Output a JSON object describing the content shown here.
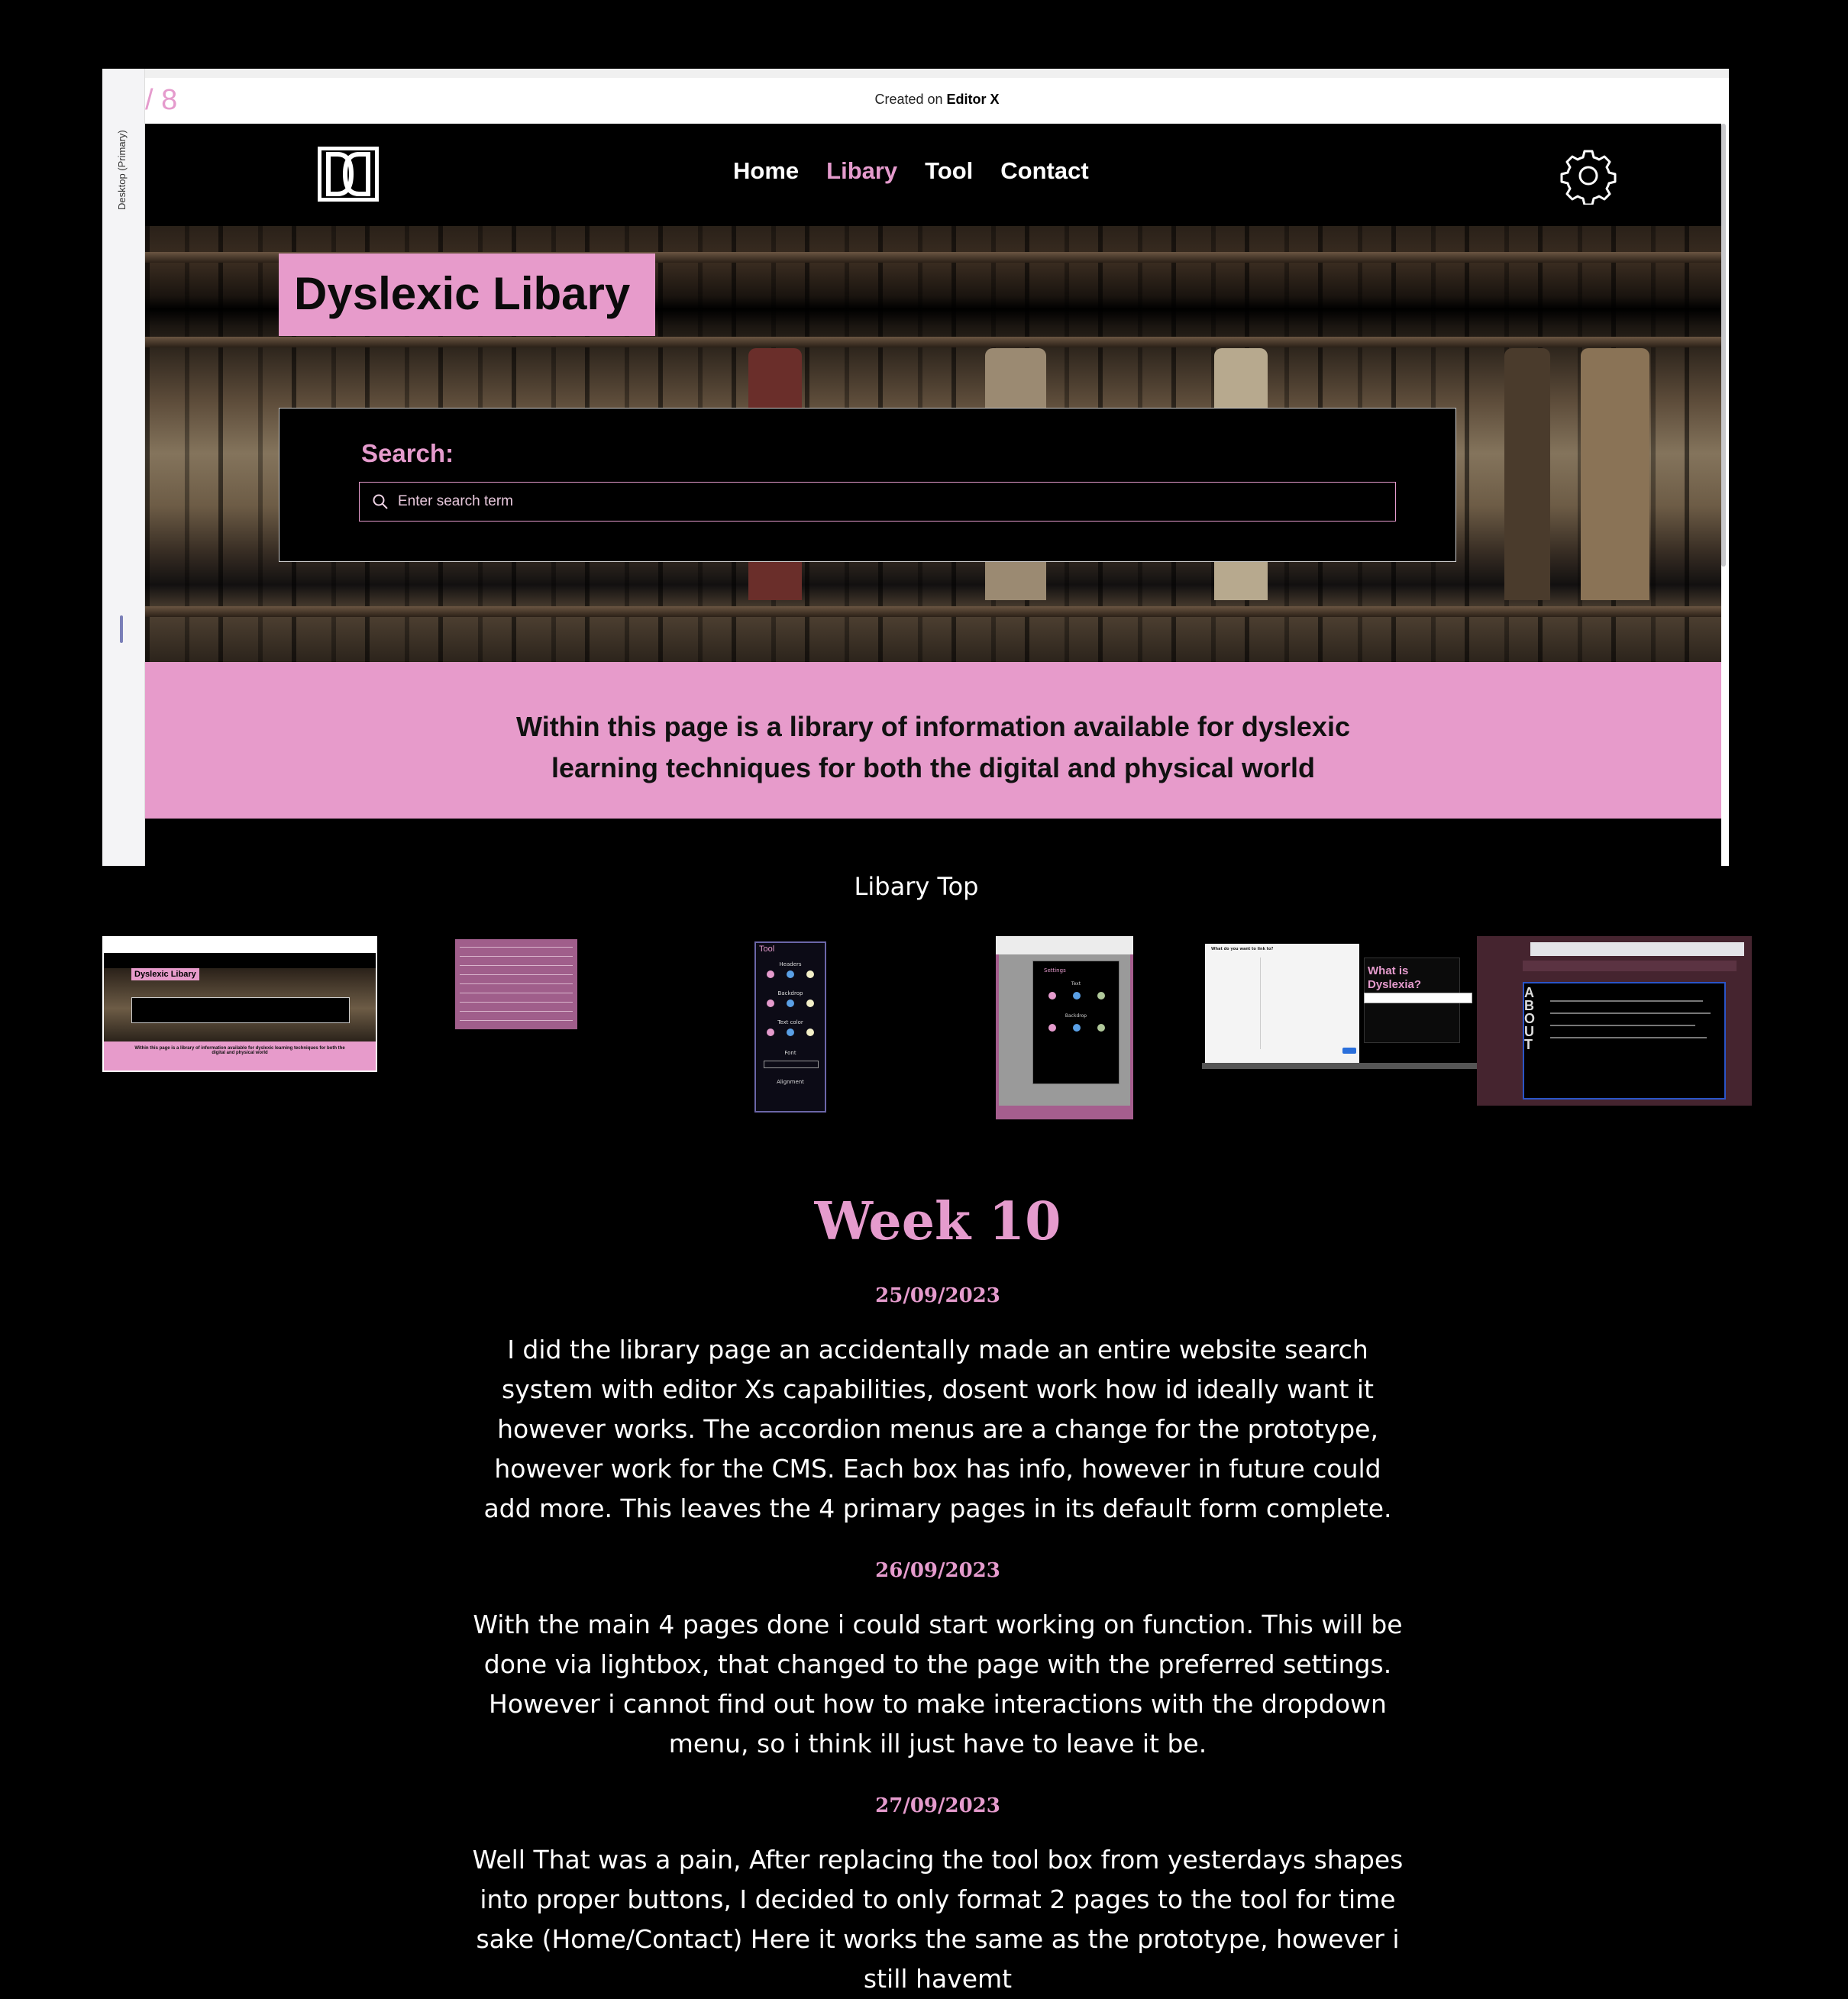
{
  "slide": {
    "counter": "/ 8",
    "rail_label": "Desktop (Primary)",
    "created_prefix": "Created on ",
    "created_brand": "Editor X"
  },
  "site": {
    "nav": [
      "Home",
      "Libary",
      "Tool",
      "Contact"
    ],
    "active_nav": "Libary",
    "hero_title": "Dyslexic Libary",
    "search_label": "Search:",
    "search_placeholder": "Enter search term",
    "band_text_line1": "Within this page is a library of information available for dyslexic",
    "band_text_line2": "learning techniques for both the digital and physical world"
  },
  "caption": "Libary Top",
  "thumbnails": {
    "t1_title": "Dyslexic Libary",
    "t1_band": "Within this page is a library of information available for dyslexic learning techniques for both the digital and physical world",
    "t3_title": "Tool",
    "t3_sections": [
      "Headers",
      "Backdrop",
      "Text color",
      "Font",
      "Alignment"
    ],
    "t4_title": "Settings",
    "t4_sections": [
      "Text",
      "Backdrop"
    ],
    "t5_question": "What do you want to link to?",
    "t5_heading": "What is Dyslexia?",
    "t6_vertical": "ABOUT"
  },
  "blog": {
    "week_title": "Week 10",
    "entries": [
      {
        "date": "25/09/2023",
        "text": "I did the library page an accidentally made an entire website search system with editor Xs capabilities, dosent work how id ideally want it however works. The accordion menus are a change for the prototype, however work for the CMS. Each box has info, however in future could add more. This leaves the 4 primary pages in its default form complete."
      },
      {
        "date": "26/09/2023",
        "text": "With the main 4 pages done i could start working on function. This will be done via lightbox, that changed to the page with the preferred settings. However i cannot find out how to make interactions with the dropdown menu, so i think ill just have to leave it be."
      },
      {
        "date": "27/09/2023",
        "text": "Well That was a pain, After replacing the tool box from yesterdays shapes into proper buttons, I decided to only format 2 pages to the tool for time sake (Home/Contact) Here it works the same as the prototype, however i still havemt"
      }
    ]
  },
  "colors": {
    "accent_pink": "#e59bcd",
    "band_pink": "#e79bcb",
    "background": "#000000"
  }
}
